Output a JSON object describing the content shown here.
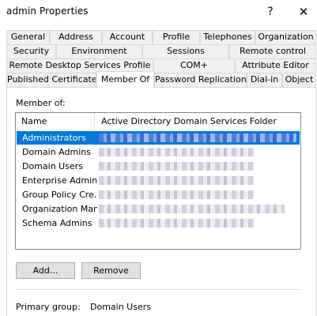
{
  "window": {
    "title": "admin Properties",
    "help_glyph": "?",
    "close_glyph": "✕"
  },
  "tabs": {
    "row1": [
      "General",
      "Address",
      "Account",
      "Profile",
      "Telephones",
      "Organization"
    ],
    "row2": [
      "Security",
      "Environment",
      "Sessions",
      "Remote control"
    ],
    "row3": [
      "Remote Desktop Services Profile",
      "COM+",
      "Attribute Editor"
    ],
    "row4": [
      "Published Certificates",
      "Member Of",
      "Password Replication",
      "Dial-in",
      "Object"
    ],
    "active": "Member Of"
  },
  "member_of": {
    "label": "Member of:",
    "columns": [
      "Name",
      "Active Directory Domain Services Folder"
    ],
    "rows": [
      {
        "name": "Administrators",
        "selected": true
      },
      {
        "name": "Domain Admins",
        "selected": false
      },
      {
        "name": "Domain Users",
        "selected": false
      },
      {
        "name": "Enterprise Admins",
        "selected": false
      },
      {
        "name": "Group Policy Cre...",
        "selected": false
      },
      {
        "name": "Organization Man...",
        "selected": false
      },
      {
        "name": "Schema Admins",
        "selected": false
      }
    ]
  },
  "buttons": {
    "add": "Add...",
    "remove": "Remove"
  },
  "primary_group": {
    "label": "Primary group:",
    "value": "Domain Users"
  },
  "colors": {
    "selection": "#0078d7",
    "tab_bg": "#f0f0f0",
    "button_bg": "#e1e1e1"
  }
}
